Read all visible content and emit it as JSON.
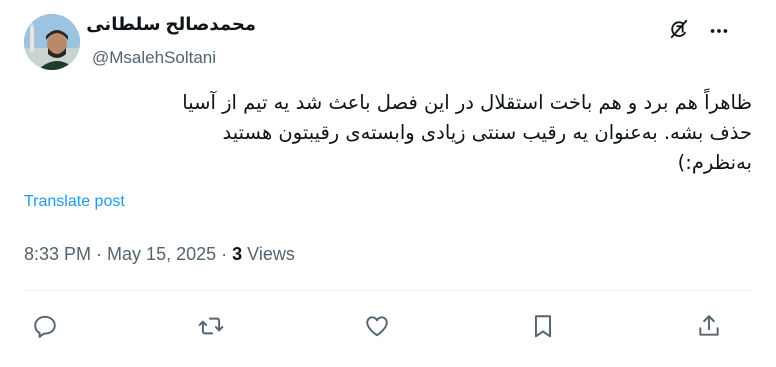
{
  "author": {
    "display_name": "محمدصالح سلطانی",
    "handle": "@MsalehSoltani"
  },
  "post": {
    "lines": [
      "ظاهراً هم برد و هم باخت استقلال در این فصل باعث شد یه تیم از آسیا",
      "حذف بشه. به‌عنوان یه رقیب سنتی زیادی وابسته‌ی رقیبتون هستید",
      "به‌نظرم:)"
    ],
    "translate_label": "Translate post"
  },
  "meta": {
    "time": "8:33 PM",
    "sep1": " · ",
    "date": "May 15, 2025",
    "sep2": " · ",
    "views_count": "3",
    "views_label": " Views"
  },
  "icons": {
    "grok": "grok-icon",
    "more": "more-icon",
    "reply": "reply-icon",
    "repost": "repost-icon",
    "like": "like-icon",
    "bookmark": "bookmark-icon",
    "share": "share-icon"
  },
  "colors": {
    "link": "#1d9bf0",
    "secondary_text": "#536471",
    "primary_text": "#0f1419"
  }
}
